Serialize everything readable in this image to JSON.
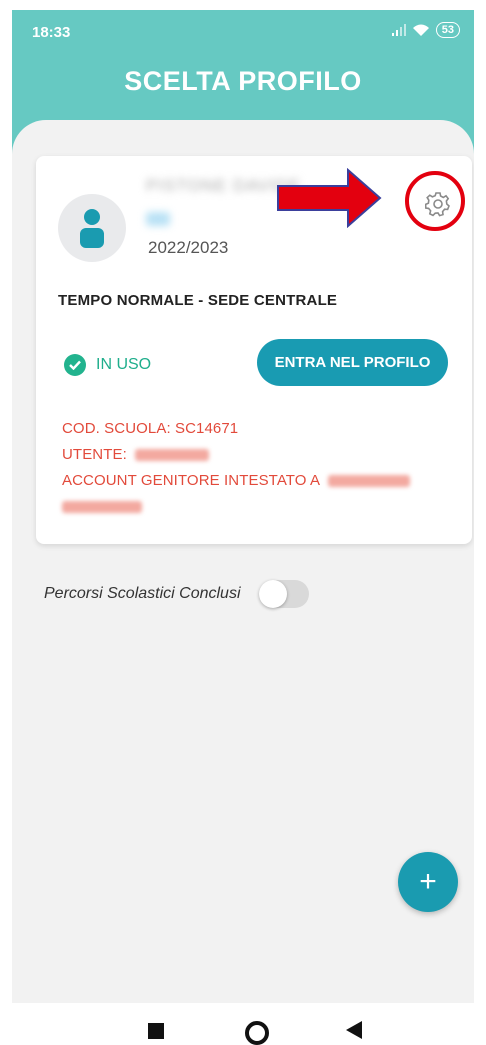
{
  "status": {
    "time": "18:33",
    "battery": "53"
  },
  "header": {
    "title": "SCELTA PROFILO"
  },
  "card": {
    "student_name_redacted": "PISTONE DAVIDE",
    "year": "2022/2023",
    "schedule": "TEMPO NORMALE - SEDE CENTRALE",
    "status_label": "IN USO",
    "enter_button": "ENTRA NEL PROFILO",
    "school_code": "COD. SCUOLA: SC14671",
    "user_label": "UTENTE:",
    "account_label": "ACCOUNT GENITORE INTESTATO A"
  },
  "toggle": {
    "label": "Percorsi Scolastici Conclusi",
    "enabled": false
  },
  "fab": {
    "label": "+"
  },
  "icons": {
    "settings": "gear-icon",
    "avatar": "user-icon",
    "status": "check-circle-icon",
    "annotation": "red-arrow"
  },
  "colors": {
    "header": "#66c9c2",
    "button": "#199bb2",
    "status_green": "#1fae8c",
    "warning_red": "#e24a3b",
    "annotation_red": "#e3000f"
  }
}
